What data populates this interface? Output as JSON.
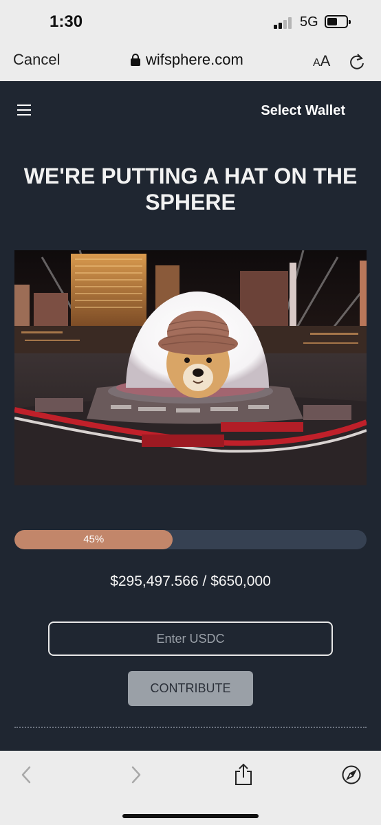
{
  "status_bar": {
    "time": "1:30",
    "network": "5G"
  },
  "browser": {
    "cancel_label": "Cancel",
    "domain": "wifsphere.com",
    "text_size_label_small": "A",
    "text_size_label_large": "A"
  },
  "site": {
    "select_wallet_label": "Select Wallet",
    "hero_title": "WE'RE PUTTING A HAT ON THE SPHERE",
    "progress": {
      "percent": 45,
      "label": "45%"
    },
    "raised_amount": "$295,497.566",
    "separator": " / ",
    "goal_amount": "$650,000",
    "usdc_input": {
      "placeholder": "Enter USDC",
      "value": ""
    },
    "contribute_label": "CONTRIBUTE"
  },
  "icons": {
    "menu": "hamburger-icon",
    "lock": "lock-icon",
    "reload": "reload-icon",
    "back": "chevron-left-icon",
    "forward": "chevron-right-icon",
    "share": "share-icon",
    "compass": "compass-icon"
  },
  "colors": {
    "page_background": "#1f2631",
    "progress_fill": "#c2866a",
    "progress_track": "#364152",
    "button_background": "#9aa0a7"
  }
}
